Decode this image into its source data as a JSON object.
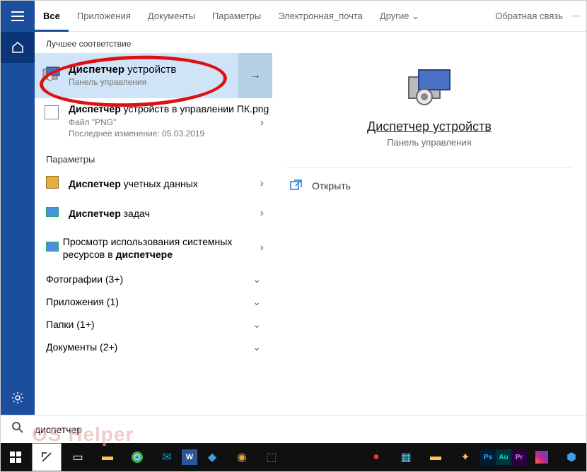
{
  "sidebar": {
    "items": [
      "menu",
      "home",
      "settings",
      "user"
    ]
  },
  "tabs": {
    "items": [
      "Все",
      "Приложения",
      "Документы",
      "Параметры",
      "Электронная_почта",
      "Другие"
    ],
    "active": 0,
    "feedback": "Обратная связь"
  },
  "left": {
    "best_match": "Лучшее соответствие",
    "r1": {
      "title_bold": "Диспетчер",
      "title_rest": " устройств",
      "sub": "Панель управления"
    },
    "r2": {
      "title_bold": "Диспетчер",
      "title_rest": " устройств в управлении ПК.png",
      "line1": "Файл \"PNG\"",
      "line2": "Последнее изменение: 05.03.2019"
    },
    "params_h": "Параметры",
    "s1": {
      "bold": "Диспетчер",
      "rest": " учетных данных"
    },
    "s2": {
      "bold": "Диспетчер",
      "rest": " задач"
    },
    "s3": {
      "pre": "Просмотр использования системных ресурсов в ",
      "bold": "диспетчере"
    },
    "cats": [
      "Фотографии (3+)",
      "Приложения (1)",
      "Папки (1+)",
      "Документы (2+)"
    ]
  },
  "right": {
    "title": "Диспетчер устройств",
    "sub": "Панель управления",
    "open": "Открыть"
  },
  "search": {
    "value": "диспетчер"
  },
  "watermark": "OS Helper"
}
